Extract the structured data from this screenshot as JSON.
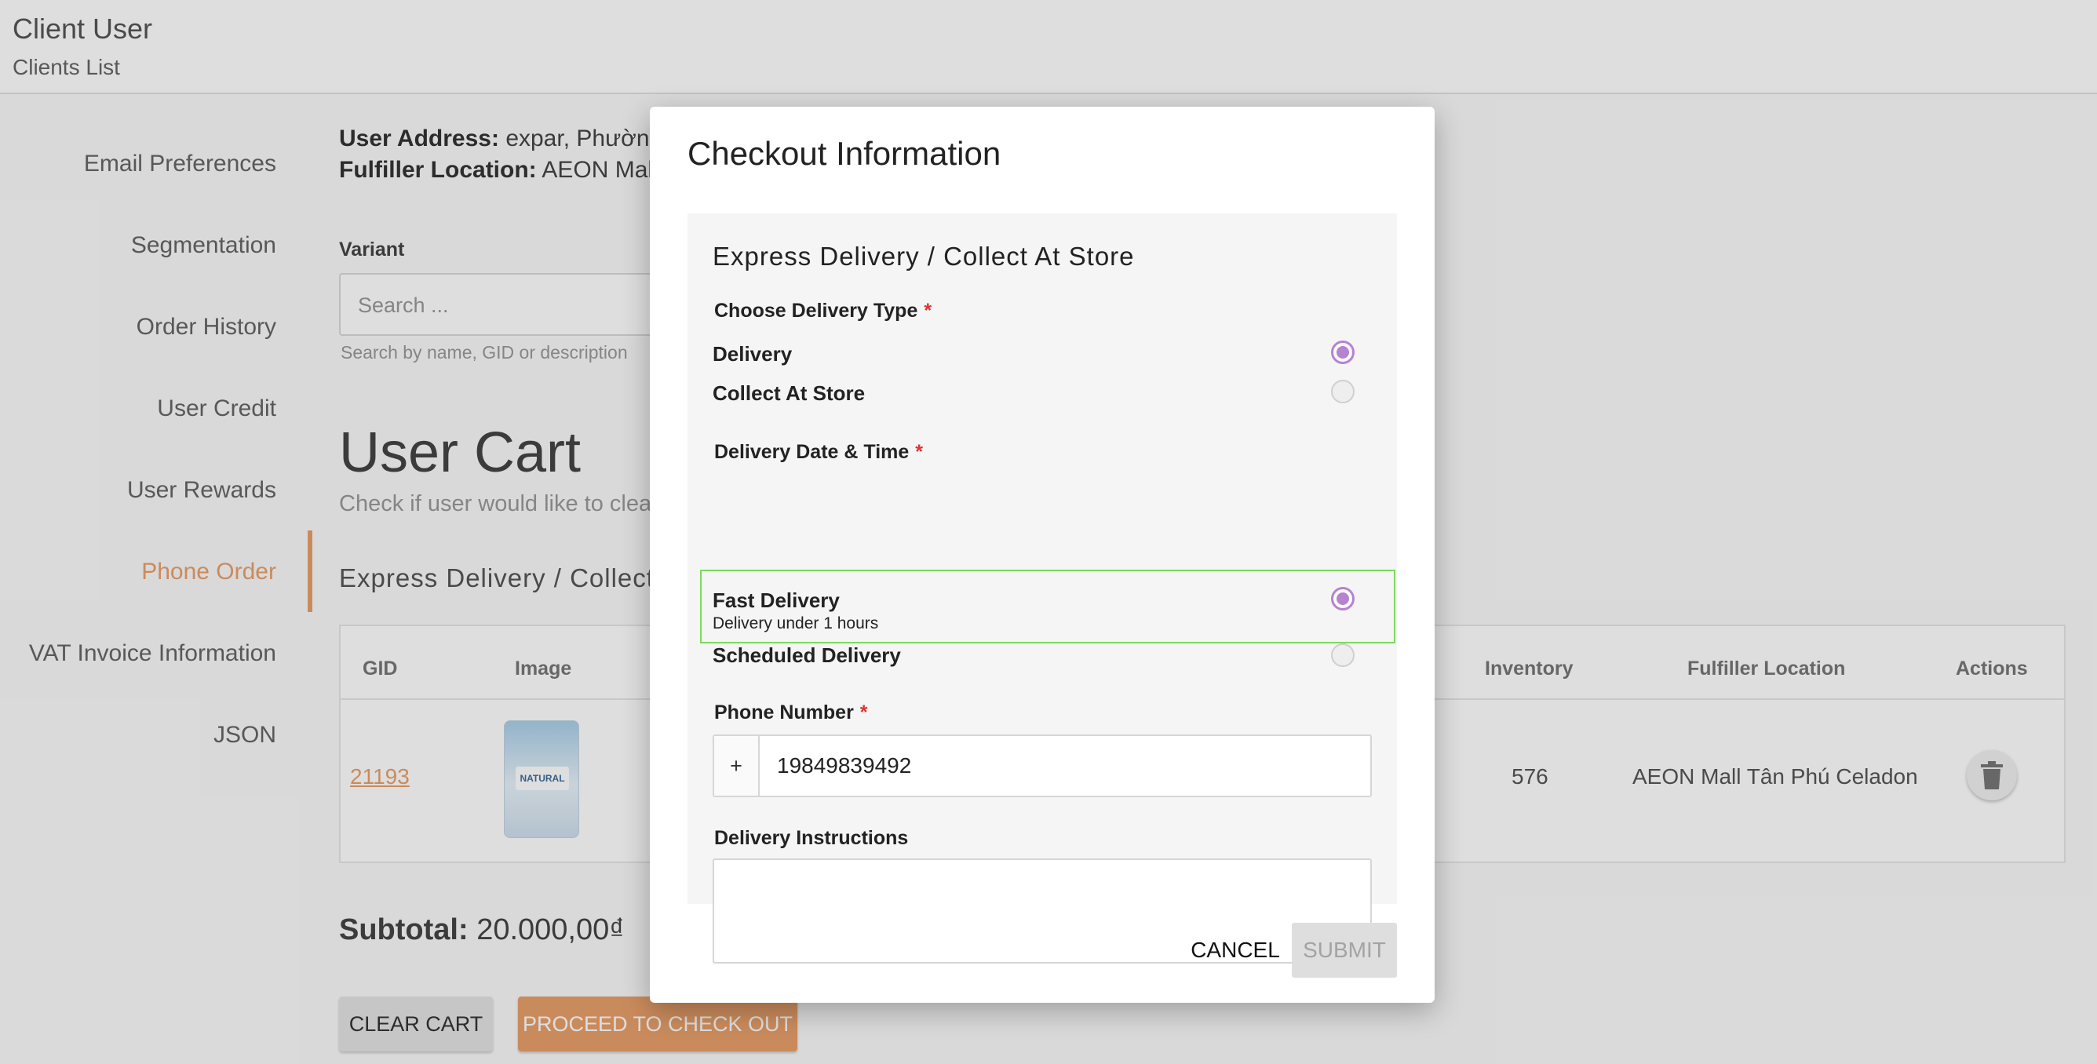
{
  "header": {
    "title": "Client User",
    "breadcrumb": "Clients List"
  },
  "sidebar": {
    "items": [
      {
        "label": "Email Preferences"
      },
      {
        "label": "Segmentation"
      },
      {
        "label": "Order History"
      },
      {
        "label": "User Credit"
      },
      {
        "label": "User Rewards"
      },
      {
        "label": "Phone Order",
        "active": true
      },
      {
        "label": "VAT Invoice Information"
      },
      {
        "label": "JSON"
      }
    ]
  },
  "main": {
    "user_address_label": "User Address:",
    "user_address_value": "expar, Phường",
    "fulfiller_label": "Fulfiller Location:",
    "fulfiller_value": "AEON Mall T",
    "variant_label": "Variant",
    "search_placeholder": "Search ...",
    "search_hint": "Search by name, GID or description",
    "cart_title": "User Cart",
    "cart_subtitle": "Check if user would like to clea",
    "section_title": "Express Delivery / Collect",
    "table": {
      "headers": {
        "gid": "GID",
        "image": "Image",
        "inventory": "Inventory",
        "fulfiller": "Fulfiller Location",
        "actions": "Actions"
      },
      "rows": [
        {
          "gid": "21193",
          "inventory": "576",
          "fulfiller": "AEON Mall Tân Phú Celadon",
          "image_icon": "product-thumbnail"
        }
      ]
    },
    "subtotal_label": "Subtotal:",
    "subtotal_value": "20.000,00₫",
    "clear_cart": "CLEAR CART",
    "checkout": "PROCEED TO CHECK OUT"
  },
  "modal": {
    "title": "Checkout Information",
    "panel_title": "Express Delivery / Collect At Store",
    "delivery_type_label": "Choose Delivery Type",
    "delivery_type_options": [
      {
        "label": "Delivery",
        "checked": true
      },
      {
        "label": "Collect At Store",
        "checked": false
      }
    ],
    "date_time_label": "Delivery Date & Time",
    "date_time_options": [
      {
        "label": "Fast Delivery",
        "sublabel": "Delivery under 1 hours",
        "checked": true
      },
      {
        "label": "Scheduled Delivery",
        "checked": false
      }
    ],
    "phone_label": "Phone Number",
    "phone_prefix": "+",
    "phone_value": "19849839492",
    "instructions_label": "Delivery Instructions",
    "instructions_value": "",
    "required_mark": "*",
    "cancel": "CANCEL",
    "submit": "SUBMIT"
  },
  "colors": {
    "accent": "#e8a06a",
    "radio": "#b782d0",
    "highlight": "#7ed85c",
    "required": "#dd3333"
  }
}
